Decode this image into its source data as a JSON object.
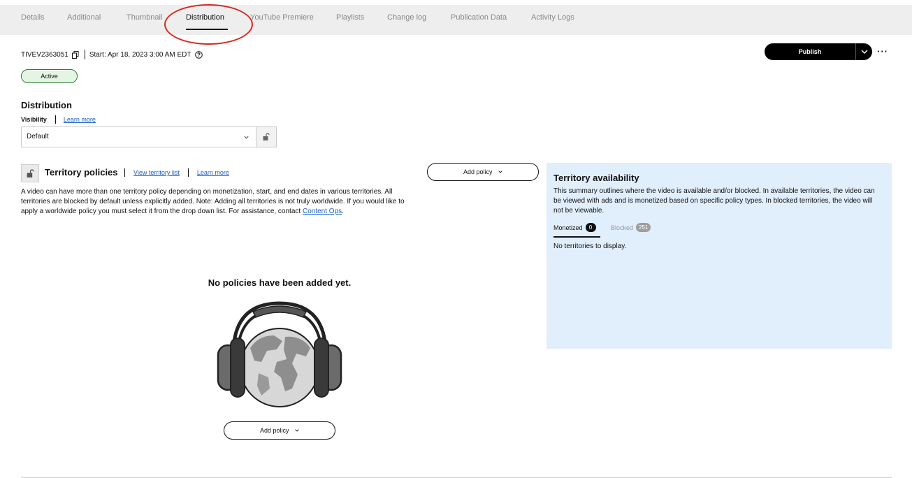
{
  "tabs": [
    {
      "label": "Details"
    },
    {
      "label": "Additional"
    },
    {
      "label": "Thumbnail"
    },
    {
      "label": "Distribution",
      "active": true
    },
    {
      "label": "YouTube Premiere"
    },
    {
      "label": "Playlists"
    },
    {
      "label": "Change log"
    },
    {
      "label": "Publication Data"
    },
    {
      "label": "Activity Logs"
    }
  ],
  "meta": {
    "video_id": "TIVEV2363051",
    "start": "Start: Apr 18, 2023 3:00 AM EDT"
  },
  "status": "Active",
  "actions": {
    "publish_label": "Publish"
  },
  "distribution": {
    "title": "Distribution",
    "visibility_label": "Visibility",
    "learn_more": "Learn more",
    "visibility_value": "Default"
  },
  "territory_policies": {
    "title": "Territory policies",
    "view_list": "View territory list",
    "learn_more": "Learn more",
    "add_policy": "Add policy",
    "description_prefix": "A video can have more than one territory policy depending on monetization, start, and end dates in various territories. All territories are blocked by default unless explicitly added. Note: Adding all territories is not truly worldwide. If you would like to apply a worldwide policy you must select it from the drop down list. For assistance, contact ",
    "contact_link": "Content Ops",
    "description_suffix": ".",
    "empty_title": "No policies have been added yet."
  },
  "availability": {
    "title": "Territory availability",
    "description": "This summary outlines where the video is available and/or blocked. In available territories, the video can be viewed with ads and is monetized based on specific policy types. In blocked territories, the video will not be viewable.",
    "tab_monetized": "Monetized",
    "monetized_count": "0",
    "tab_blocked": "Blocked",
    "blocked_count": "251",
    "empty": "No territories to display."
  },
  "colors": {
    "accent": "#000000",
    "status_green": "#2e7d32",
    "panel_blue": "#e1eefb",
    "link_blue": "#1a5fc9",
    "annotation_red": "#d6281e"
  }
}
